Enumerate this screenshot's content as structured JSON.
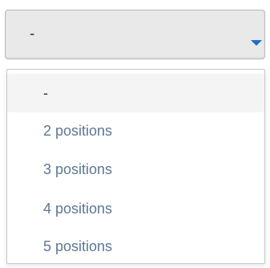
{
  "select": {
    "value": "-",
    "caret_icon": "caret-down-icon",
    "accent_color": "#1e6fc9"
  },
  "dropdown": {
    "options": [
      {
        "label": "-",
        "selected": true
      },
      {
        "label": "2 positions",
        "selected": false
      },
      {
        "label": "3 positions",
        "selected": false
      },
      {
        "label": "4 positions",
        "selected": false
      },
      {
        "label": "5 positions",
        "selected": false
      }
    ],
    "option_text_color": "#5d7795"
  }
}
